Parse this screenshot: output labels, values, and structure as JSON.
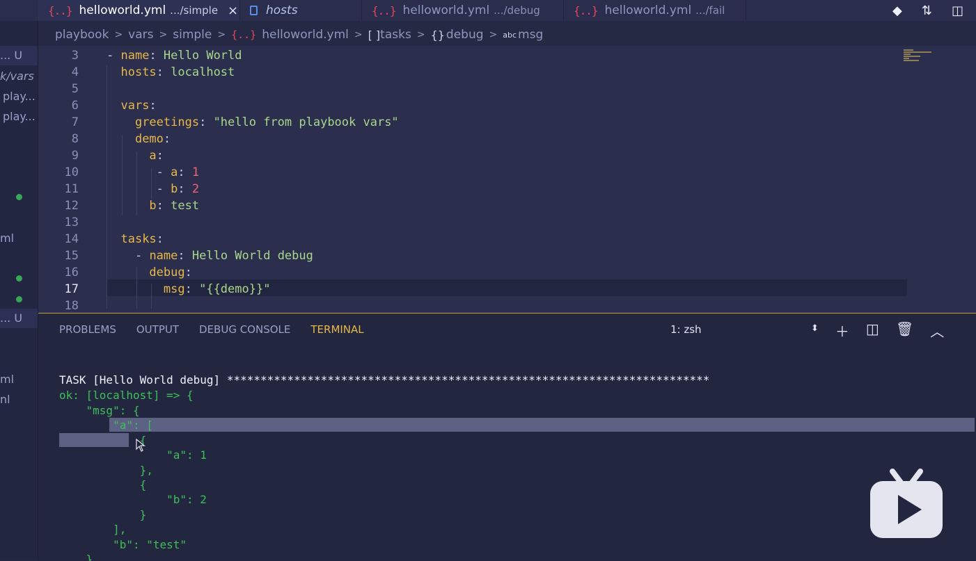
{
  "tabs": [
    {
      "icon": "{..}",
      "label": "helloworld.yml",
      "desc": ".../simple",
      "active": true,
      "close": "×"
    },
    {
      "icon": "file",
      "label": "hosts",
      "desc": "",
      "active": false
    },
    {
      "icon": "{..}",
      "label": "helloworld.yml",
      "desc": ".../debug",
      "active": false
    },
    {
      "icon": "{..}",
      "label": "helloworld.yml",
      "desc": ".../fail",
      "active": false
    }
  ],
  "breadcrumb": {
    "items": [
      "playbook",
      "vars",
      "simple",
      "helloworld.yml",
      "tasks",
      "debug",
      "msg"
    ],
    "yaml_icon": "{..}",
    "array_icon": "[ ]",
    "object_icon": "{}",
    "string_icon": "abc"
  },
  "sidebar": {
    "rows": [
      {
        "text": "... U"
      },
      {
        "text": "k/vars"
      },
      {
        "text": "play..."
      },
      {
        "text": "play..."
      },
      {
        "text": "ml"
      },
      {
        "text": "... U"
      },
      {
        "text": "ml"
      },
      {
        "text": "nl"
      }
    ]
  },
  "editor": {
    "lines": [
      {
        "n": "3"
      },
      {
        "n": "4"
      },
      {
        "n": "5"
      },
      {
        "n": "6"
      },
      {
        "n": "7"
      },
      {
        "n": "8"
      },
      {
        "n": "9"
      },
      {
        "n": "10"
      },
      {
        "n": "11"
      },
      {
        "n": "12"
      },
      {
        "n": "13"
      },
      {
        "n": "14"
      },
      {
        "n": "15"
      },
      {
        "n": "16"
      },
      {
        "n": "17"
      },
      {
        "n": "18"
      }
    ],
    "tokens": {
      "l3_dash": "- ",
      "l3_key": "name",
      "l3_val": "Hello World",
      "l4_key": "hosts",
      "l4_val": "localhost",
      "l6_key": "vars",
      "l7_key": "greetings",
      "l7_val": "\"hello from playbook vars\"",
      "l8_key": "demo",
      "l9_key": "a",
      "l10_key": "a",
      "l10_val": "1",
      "l11_key": "b",
      "l11_val": "2",
      "l12_key": "b",
      "l12_val": "test",
      "l14_key": "tasks",
      "l15_key": "name",
      "l15_val": "Hello World debug",
      "l16_key": "debug",
      "l17_key": "msg",
      "l17_val": "\"{{demo}}\""
    }
  },
  "panel": {
    "tabs": [
      "PROBLEMS",
      "OUTPUT",
      "DEBUG CONSOLE",
      "TERMINAL"
    ],
    "active_tab": "TERMINAL",
    "shell": "1: zsh",
    "terminal": [
      "TASK [Hello World debug] ************************************************************************",
      "ok: [localhost] => {",
      "    \"msg\": {",
      "        \"a\": [",
      "            {",
      "                \"a\": 1",
      "            },",
      "            {",
      "                \"b\": 2",
      "            }",
      "        ],",
      "        \"b\": \"test\"",
      "    }"
    ]
  },
  "colors": {
    "accent": "#e8b84a",
    "string": "#a8d88c",
    "number": "#f0627a",
    "terminal_green": "#3fbf5a",
    "yaml_icon": "#e0485c"
  }
}
